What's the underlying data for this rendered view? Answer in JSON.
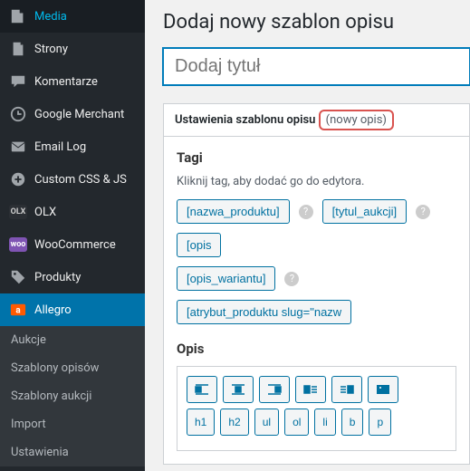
{
  "sidebar": {
    "items": [
      {
        "label": "Media",
        "icon": "media"
      },
      {
        "label": "Strony",
        "icon": "pages"
      },
      {
        "label": "Komentarze",
        "icon": "comments"
      },
      {
        "label": "Google Merchant",
        "icon": "google"
      },
      {
        "label": "Email Log",
        "icon": "email"
      },
      {
        "label": "Custom CSS & JS",
        "icon": "plus"
      },
      {
        "label": "OLX",
        "icon": "olx",
        "badge": "OLX"
      },
      {
        "label": "WooCommerce",
        "icon": "woo",
        "badge": "woo"
      },
      {
        "label": "Produkty",
        "icon": "products"
      },
      {
        "label": "Allegro",
        "icon": "allegro"
      }
    ],
    "submenu": [
      "Aukcje",
      "Szablony opisów",
      "Szablony aukcji",
      "Import",
      "Ustawienia"
    ]
  },
  "page": {
    "heading": "Dodaj nowy szablon opisu",
    "title_placeholder": "Dodaj tytuł"
  },
  "panel": {
    "header_text": "Ustawienia szablonu opisu",
    "header_highlight": "(nowy opis)",
    "tags_heading": "Tagi",
    "tags_hint": "Kliknij tag, aby dodać go do edytora.",
    "tags_row1": [
      "[nazwa_produktu]",
      "[tytul_aukcji]",
      "[opis"
    ],
    "tags_row2": [
      "[opis_wariantu]",
      "[atrybut_produktu slug=\"nazw"
    ],
    "desc_heading": "Opis",
    "format_buttons": [
      "h1",
      "h2",
      "ul",
      "ol",
      "li",
      "b",
      "p"
    ]
  }
}
